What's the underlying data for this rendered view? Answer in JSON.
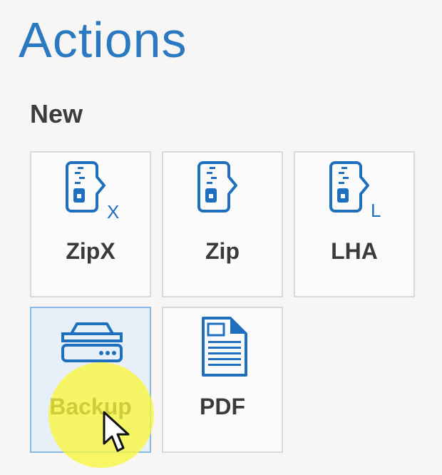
{
  "panel": {
    "title": "Actions",
    "section_label": "New"
  },
  "tiles": [
    {
      "label": "ZipX",
      "icon": "zipx-archive-icon",
      "selected": false
    },
    {
      "label": "Zip",
      "icon": "zip-archive-icon",
      "selected": false
    },
    {
      "label": "LHA",
      "icon": "lha-archive-icon",
      "selected": false
    },
    {
      "label": "Backup",
      "icon": "backup-drive-icon",
      "selected": true
    },
    {
      "label": "PDF",
      "icon": "pdf-document-icon",
      "selected": false
    }
  ],
  "icon_badges": {
    "zipx": "X",
    "lha": "L"
  },
  "colors": {
    "title": "#2a79c1",
    "icon": "#1f6fbf",
    "selected_tile": "#e7f0f9",
    "cursor_highlight": "#f8f63c"
  }
}
